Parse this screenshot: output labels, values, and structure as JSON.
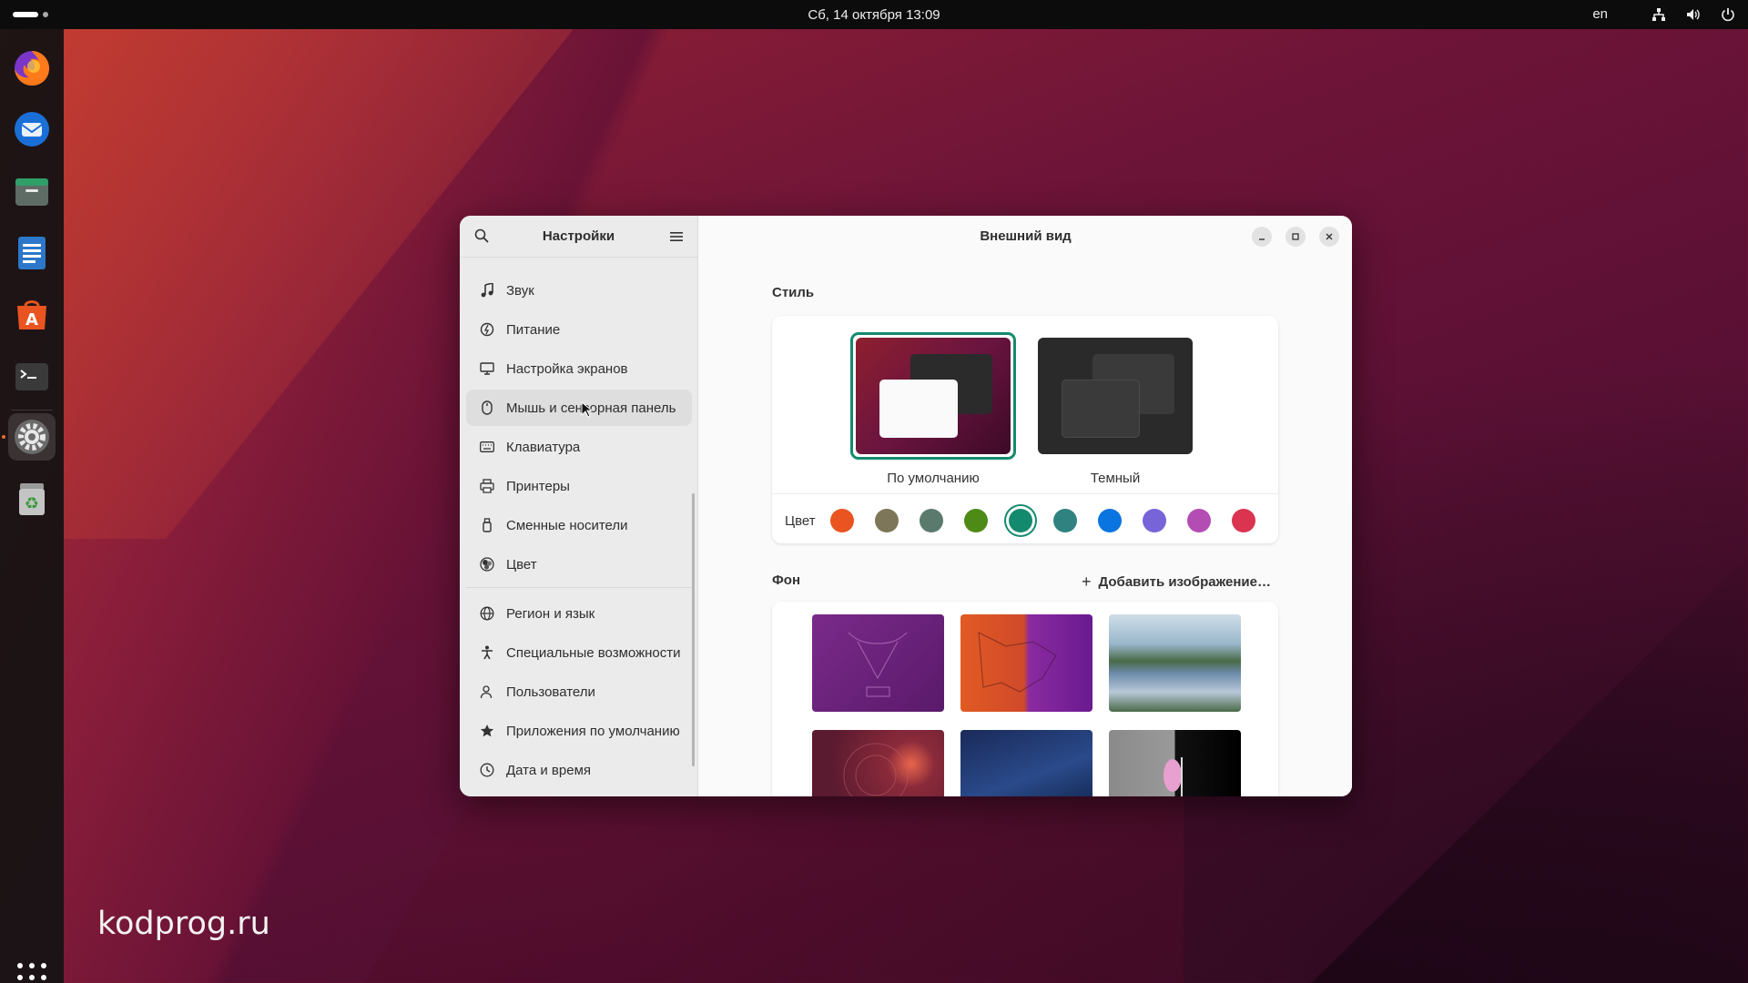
{
  "topbar": {
    "clock": "Сб, 14 октября  13:09",
    "lang": "en"
  },
  "watermark": "kodprog.ru",
  "dock": {
    "items": [
      "firefox-icon",
      "thunderbird-icon",
      "files-icon",
      "writer-icon",
      "app-center-icon",
      "terminal-icon",
      "settings-icon",
      "trash-icon"
    ]
  },
  "sidebar": {
    "title": "Настройки",
    "items": [
      {
        "label": "Звук",
        "icon": "music-note-icon"
      },
      {
        "label": "Питание",
        "icon": "power-icon"
      },
      {
        "label": "Настройка экранов",
        "icon": "display-icon"
      },
      {
        "label": "Мышь и сенсорная панель",
        "icon": "mouse-icon"
      },
      {
        "label": "Клавиатура",
        "icon": "keyboard-icon"
      },
      {
        "label": "Принтеры",
        "icon": "printer-icon"
      },
      {
        "label": "Сменные носители",
        "icon": "usb-drive-icon"
      },
      {
        "label": "Цвет",
        "icon": "color-icon"
      },
      {
        "label": "Регион и язык",
        "icon": "globe-icon"
      },
      {
        "label": "Специальные возможности",
        "icon": "accessibility-icon"
      },
      {
        "label": "Пользователи",
        "icon": "users-icon"
      },
      {
        "label": "Приложения по умолчанию",
        "icon": "star-icon"
      },
      {
        "label": "Дата и время",
        "icon": "clock-icon"
      }
    ]
  },
  "main": {
    "title": "Внешний вид",
    "style_section": "Стиль",
    "style_options": [
      {
        "label": "По умолчанию",
        "selected": true
      },
      {
        "label": "Темный",
        "selected": false
      }
    ],
    "color_label": "Цвет",
    "accent_colors": [
      "#e95420",
      "#7d7659",
      "#5b7a6e",
      "#4e8a16",
      "#138a6e",
      "#308280",
      "#0a74e0",
      "#7764d8",
      "#b34cb3",
      "#da3450"
    ],
    "selected_accent_index": 4,
    "background_section": "Фон",
    "add_image": "Добавить изображение…"
  }
}
